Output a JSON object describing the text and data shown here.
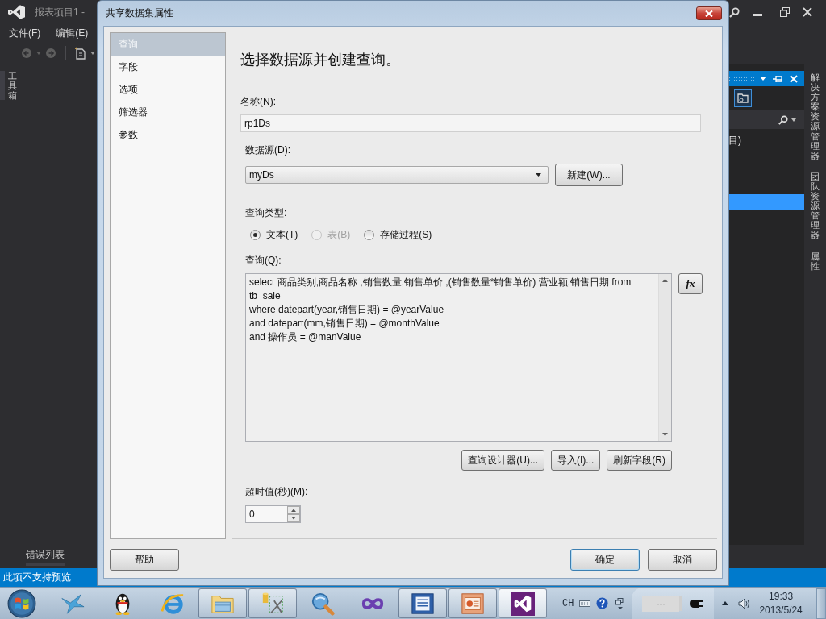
{
  "ide": {
    "title": "报表项目1 -",
    "menu": [
      {
        "label": "文件(F)"
      },
      {
        "label": "编辑(E)"
      }
    ],
    "toolbox_tab": "工具箱",
    "solution_panel": {
      "tree_rows": [
        {
          "label": "目)",
          "selected": false
        },
        {
          "selected": true
        }
      ]
    },
    "right_tabs": [
      "解决方案资源管理器",
      "团队资源管理器",
      "属性"
    ],
    "bottom_tab": "错误列表",
    "status": "此项不支持预览"
  },
  "dialog": {
    "title": "共享数据集属性",
    "nav": [
      {
        "label": "查询",
        "selected": true
      },
      {
        "label": "字段",
        "selected": false
      },
      {
        "label": "选项",
        "selected": false
      },
      {
        "label": "筛选器",
        "selected": false
      },
      {
        "label": "参数",
        "selected": false
      }
    ],
    "heading": "选择数据源并创建查询。",
    "name": {
      "label": "名称(N):",
      "value": "rp1Ds"
    },
    "data_source": {
      "label": "数据源(D):",
      "value": "myDs",
      "button": "新建(W)..."
    },
    "query_type": {
      "label": "查询类型:",
      "options": [
        {
          "label": "文本(T)",
          "selected": true,
          "disabled": false
        },
        {
          "label": "表(B)",
          "selected": false,
          "disabled": true
        },
        {
          "label": "存储过程(S)",
          "selected": false,
          "disabled": false
        }
      ]
    },
    "query": {
      "label": "查询(Q):",
      "value": "select 商品类别,商品名称 ,销售数量,销售单价 ,(销售数量*销售单价) 营业额,销售日期 from tb_sale\nwhere datepart(year,销售日期) = @yearValue\nand datepart(mm,销售日期) = @monthValue\nand 操作员 = @manValue",
      "expression_button": "fx"
    },
    "query_buttons": [
      "查询设计器(U)...",
      "导入(I)...",
      "刷新字段(R)"
    ],
    "timeout": {
      "label": "超时值(秒)(M):",
      "value": "0"
    },
    "help_button": "帮助",
    "buttons": [
      {
        "label": "确定",
        "default": true
      },
      {
        "label": "取消",
        "default": false
      }
    ]
  },
  "taskbar": {
    "apps": [
      {
        "kind": "bird",
        "running": false,
        "selected": false
      },
      {
        "kind": "penguin",
        "running": false,
        "selected": false
      },
      {
        "kind": "ring",
        "running": false,
        "selected": false
      },
      {
        "kind": "folder",
        "running": true,
        "selected": false
      },
      {
        "kind": "database",
        "running": true,
        "selected": false
      },
      {
        "kind": "magnifier",
        "running": false,
        "selected": false
      },
      {
        "kind": "infinity",
        "running": false,
        "selected": false
      },
      {
        "kind": "document",
        "running": true,
        "selected": false
      },
      {
        "kind": "slides",
        "running": true,
        "selected": false
      },
      {
        "kind": "ribbon",
        "running": true,
        "selected": true
      }
    ],
    "language": "CH",
    "indicator": "---",
    "time": "19:33",
    "date": "2013/5/24"
  }
}
